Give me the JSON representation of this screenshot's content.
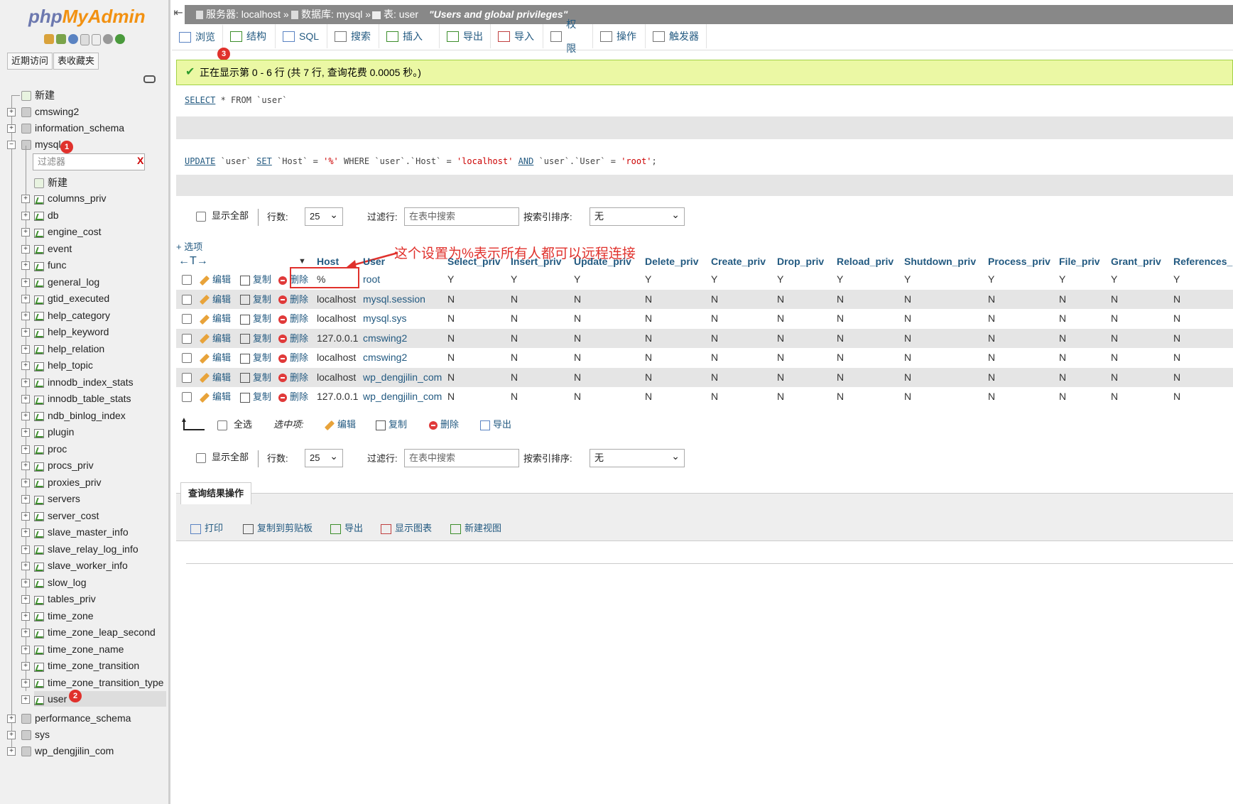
{
  "sidebar": {
    "logo_php": "php",
    "logo_myadmin": "MyAdmin",
    "recent_btn": "近期访问",
    "favorites_btn": "表收藏夹",
    "new_label": "新建",
    "filter_placeholder": "过滤器",
    "filter_clear": "X",
    "databases": [
      {
        "name": "cmswing2"
      },
      {
        "name": "information_schema"
      },
      {
        "name": "mysql"
      },
      {
        "name": "performance_schema"
      },
      {
        "name": "sys"
      },
      {
        "name": "wp_dengjilin_com"
      }
    ],
    "mysql_tables": [
      "columns_priv",
      "db",
      "engine_cost",
      "event",
      "func",
      "general_log",
      "gtid_executed",
      "help_category",
      "help_keyword",
      "help_relation",
      "help_topic",
      "innodb_index_stats",
      "innodb_table_stats",
      "ndb_binlog_index",
      "plugin",
      "proc",
      "procs_priv",
      "proxies_priv",
      "servers",
      "server_cost",
      "slave_master_info",
      "slave_relay_log_info",
      "slave_worker_info",
      "slow_log",
      "tables_priv",
      "time_zone",
      "time_zone_leap_second",
      "time_zone_name",
      "time_zone_transition",
      "time_zone_transition_type",
      "user"
    ]
  },
  "badges": {
    "one": "1",
    "two": "2",
    "three": "3"
  },
  "breadcrumb": {
    "server_label": "服务器: localhost",
    "db_label": "数据库: mysql",
    "table_label": "表: user",
    "comment": "\"Users and global privileges\""
  },
  "tabs": [
    "浏览",
    "结构",
    "SQL",
    "搜索",
    "插入",
    "导出",
    "导入",
    "权限",
    "操作",
    "触发器"
  ],
  "success_message": "正在显示第 0 - 6 行 (共 7 行, 查询花费 0.0005 秒。)",
  "sql_select": {
    "kw": "SELECT",
    "rest": " * FROM `user`"
  },
  "sql_update": {
    "kw1": "UPDATE",
    "p1": " `user` ",
    "kw2": "SET",
    "p2": " `Host` = ",
    "s1": "'%'",
    "p3": " WHERE `user`.`Host` = ",
    "s2": "'localhost'",
    "p4": " ",
    "kw3": "AND",
    "p5": " `user`.`User` = ",
    "s3": "'root'",
    "p6": ";"
  },
  "controls": {
    "show_all": "显示全部",
    "rows_label": "行数:",
    "rows_value": "25",
    "filter_rows_label": "过滤行:",
    "filter_rows_placeholder": "在表中搜索",
    "sort_label": "按索引排序:",
    "sort_value": "无"
  },
  "options_link": "+ 选项",
  "annotation": "这个设置为%表示所有人都可以远程连接",
  "columns": [
    "Host",
    "User",
    "Select_priv",
    "Insert_priv",
    "Update_priv",
    "Delete_priv",
    "Create_priv",
    "Drop_priv",
    "Reload_priv",
    "Shutdown_priv",
    "Process_priv",
    "File_priv",
    "Grant_priv",
    "References_p"
  ],
  "row_actions": {
    "edit": "编辑",
    "copy": "复制",
    "delete": "删除"
  },
  "rows": [
    {
      "host": "%",
      "user": "root",
      "privs": [
        "Y",
        "Y",
        "Y",
        "Y",
        "Y",
        "Y",
        "Y",
        "Y",
        "Y",
        "Y",
        "Y",
        "Y"
      ]
    },
    {
      "host": "localhost",
      "user": "mysql.session",
      "privs": [
        "N",
        "N",
        "N",
        "N",
        "N",
        "N",
        "N",
        "N",
        "N",
        "N",
        "N",
        "N"
      ]
    },
    {
      "host": "localhost",
      "user": "mysql.sys",
      "privs": [
        "N",
        "N",
        "N",
        "N",
        "N",
        "N",
        "N",
        "N",
        "N",
        "N",
        "N",
        "N"
      ]
    },
    {
      "host": "127.0.0.1",
      "user": "cmswing2",
      "privs": [
        "N",
        "N",
        "N",
        "N",
        "N",
        "N",
        "N",
        "N",
        "N",
        "N",
        "N",
        "N"
      ]
    },
    {
      "host": "localhost",
      "user": "cmswing2",
      "privs": [
        "N",
        "N",
        "N",
        "N",
        "N",
        "N",
        "N",
        "N",
        "N",
        "N",
        "N",
        "N"
      ]
    },
    {
      "host": "localhost",
      "user": "wp_dengjilin_com",
      "privs": [
        "N",
        "N",
        "N",
        "N",
        "N",
        "N",
        "N",
        "N",
        "N",
        "N",
        "N",
        "N"
      ]
    },
    {
      "host": "127.0.0.1",
      "user": "wp_dengjilin_com",
      "privs": [
        "N",
        "N",
        "N",
        "N",
        "N",
        "N",
        "N",
        "N",
        "N",
        "N",
        "N",
        "N"
      ]
    }
  ],
  "bulk": {
    "select_all": "全选",
    "with_selected": "选中项:",
    "edit": "编辑",
    "copy": "复制",
    "delete": "删除",
    "export": "导出"
  },
  "result_ops": {
    "title": "查询结果操作",
    "items": [
      "打印",
      "复制到剪贴板",
      "导出",
      "显示图表",
      "新建视图"
    ]
  },
  "colors": {
    "link": "#235a81",
    "success_bg": "#ebf8a4",
    "annotation": "#e0312c"
  }
}
